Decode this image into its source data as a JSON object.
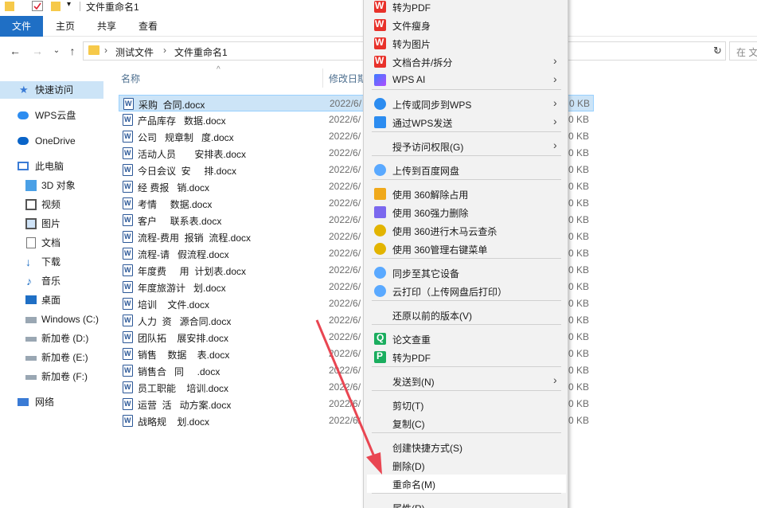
{
  "window": {
    "title": "文件重命名1"
  },
  "ribbon": {
    "tabs": [
      {
        "label": "文件"
      },
      {
        "label": "主页"
      },
      {
        "label": "共享"
      },
      {
        "label": "查看"
      }
    ]
  },
  "address": {
    "crumbs": [
      "测试文件",
      "文件重命名1"
    ],
    "search_placeholder": "在 文"
  },
  "sidebar": {
    "items": [
      {
        "label": "快速访问",
        "icon": "star-icon"
      },
      {
        "label": "WPS云盘",
        "icon": "cloud-icon"
      },
      {
        "label": "OneDrive",
        "icon": "onedrive-icon"
      },
      {
        "label": "此电脑",
        "icon": "computer-icon"
      },
      {
        "label": "3D 对象",
        "icon": "3d-objects-icon"
      },
      {
        "label": "视频",
        "icon": "video-icon"
      },
      {
        "label": "图片",
        "icon": "pictures-icon"
      },
      {
        "label": "文档",
        "icon": "documents-icon"
      },
      {
        "label": "下载",
        "icon": "download-icon"
      },
      {
        "label": "音乐",
        "icon": "music-icon"
      },
      {
        "label": "桌面",
        "icon": "desktop-icon"
      },
      {
        "label": "Windows (C:)",
        "icon": "drive-icon"
      },
      {
        "label": "新加卷 (D:)",
        "icon": "drive-icon"
      },
      {
        "label": "新加卷 (E:)",
        "icon": "drive-icon"
      },
      {
        "label": "新加卷 (F:)",
        "icon": "drive-icon"
      },
      {
        "label": "网络",
        "icon": "network-icon"
      }
    ]
  },
  "filelist": {
    "columns": {
      "name": "名称",
      "date": "修改日期"
    },
    "files": [
      {
        "name": "采购  合同.docx",
        "date": "2022/6/",
        "size": "0 KB"
      },
      {
        "name": "产品库存   数据.docx",
        "date": "2022/6/",
        "size": "0 KB"
      },
      {
        "name": "公司   规章制   度.docx",
        "date": "2022/6/",
        "size": "0 KB"
      },
      {
        "name": "活动人员       安排表.docx",
        "date": "2022/6/",
        "size": "0 KB"
      },
      {
        "name": "今日会议  安     排.docx",
        "date": "2022/6/",
        "size": "0 KB"
      },
      {
        "name": "经 费报   销.docx",
        "date": "2022/6/",
        "size": "0 KB"
      },
      {
        "name": "考情     数据.docx",
        "date": "2022/6/",
        "size": "0 KB"
      },
      {
        "name": "客户     联系表.docx",
        "date": "2022/6/",
        "size": "0 KB"
      },
      {
        "name": "流程-费用  报销  流程.docx",
        "date": "2022/6/",
        "size": "0 KB"
      },
      {
        "name": "流程-请   假流程.docx",
        "date": "2022/6/",
        "size": "0 KB"
      },
      {
        "name": "年度费     用  计划表.docx",
        "date": "2022/6/",
        "size": "0 KB"
      },
      {
        "name": "年度旅游计   划.docx",
        "date": "2022/6/",
        "size": "0 KB"
      },
      {
        "name": "培训    文件.docx",
        "date": "2022/6/",
        "size": "0 KB"
      },
      {
        "name": "人力  资   源合同.docx",
        "date": "2022/6/",
        "size": "0 KB"
      },
      {
        "name": "团队拓    展安排.docx",
        "date": "2022/6/",
        "size": "0 KB"
      },
      {
        "name": "销售    数据    表.docx",
        "date": "2022/6/",
        "size": "0 KB"
      },
      {
        "name": "销售合   同     .docx",
        "date": "2022/6/",
        "size": "0 KB"
      },
      {
        "name": "员工职能    培训.docx",
        "date": "2022/6/",
        "size": "0 KB"
      },
      {
        "name": "运营  活   动方案.docx",
        "date": "2022/6/",
        "size": "0 KB"
      },
      {
        "name": "战略规    划.docx",
        "date": "2022/6/",
        "size": "0 KB"
      }
    ]
  },
  "context_menu": {
    "items": [
      {
        "label": "转为PDF",
        "icon": "wps-icon",
        "submenu": false
      },
      {
        "label": "文件瘦身",
        "icon": "wps-icon",
        "submenu": false
      },
      {
        "label": "转为图片",
        "icon": "wps-icon",
        "submenu": false
      },
      {
        "label": "文档合并/拆分",
        "icon": "wps-icon",
        "submenu": true
      },
      {
        "label": "WPS AI",
        "icon": "wps-ai-icon",
        "submenu": true
      },
      {
        "label": "上传或同步到WPS",
        "icon": "wps-cloud-icon",
        "submenu": true
      },
      {
        "label": "通过WPS发送",
        "icon": "share-icon",
        "submenu": true
      },
      {
        "label": "授予访问权限(G)",
        "icon": "",
        "submenu": true
      },
      {
        "label": "上传到百度网盘",
        "icon": "baidu-netdisk-icon",
        "submenu": false
      },
      {
        "label": "使用 360解除占用",
        "icon": "360-unlock-icon",
        "submenu": false
      },
      {
        "label": "使用 360强力删除",
        "icon": "360-delete-icon",
        "submenu": false
      },
      {
        "label": "使用 360进行木马云查杀",
        "icon": "360-scan-icon",
        "submenu": false
      },
      {
        "label": "使用 360管理右键菜单",
        "icon": "360-menu-icon",
        "submenu": false
      },
      {
        "label": "同步至其它设备",
        "icon": "baidu-netdisk-icon",
        "submenu": false
      },
      {
        "label": "云打印（上传网盘后打印）",
        "icon": "baidu-netdisk-icon",
        "submenu": false
      },
      {
        "label": "还原以前的版本(V)",
        "icon": "",
        "submenu": false
      },
      {
        "label": "论文查重",
        "icon": "paper-check-icon",
        "submenu": false
      },
      {
        "label": "转为PDF",
        "icon": "pdf-convert-icon",
        "submenu": false
      },
      {
        "label": "发送到(N)",
        "icon": "",
        "submenu": true
      },
      {
        "label": "剪切(T)",
        "icon": "",
        "submenu": false
      },
      {
        "label": "复制(C)",
        "icon": "",
        "submenu": false
      },
      {
        "label": "创建快捷方式(S)",
        "icon": "",
        "submenu": false
      },
      {
        "label": "删除(D)",
        "icon": "",
        "submenu": false
      },
      {
        "label": "重命名(M)",
        "icon": "",
        "submenu": false,
        "highlighted": true
      },
      {
        "label": "属性(R)",
        "icon": "",
        "submenu": false
      }
    ]
  },
  "annotation": {
    "arrow_color": "#e94652"
  }
}
